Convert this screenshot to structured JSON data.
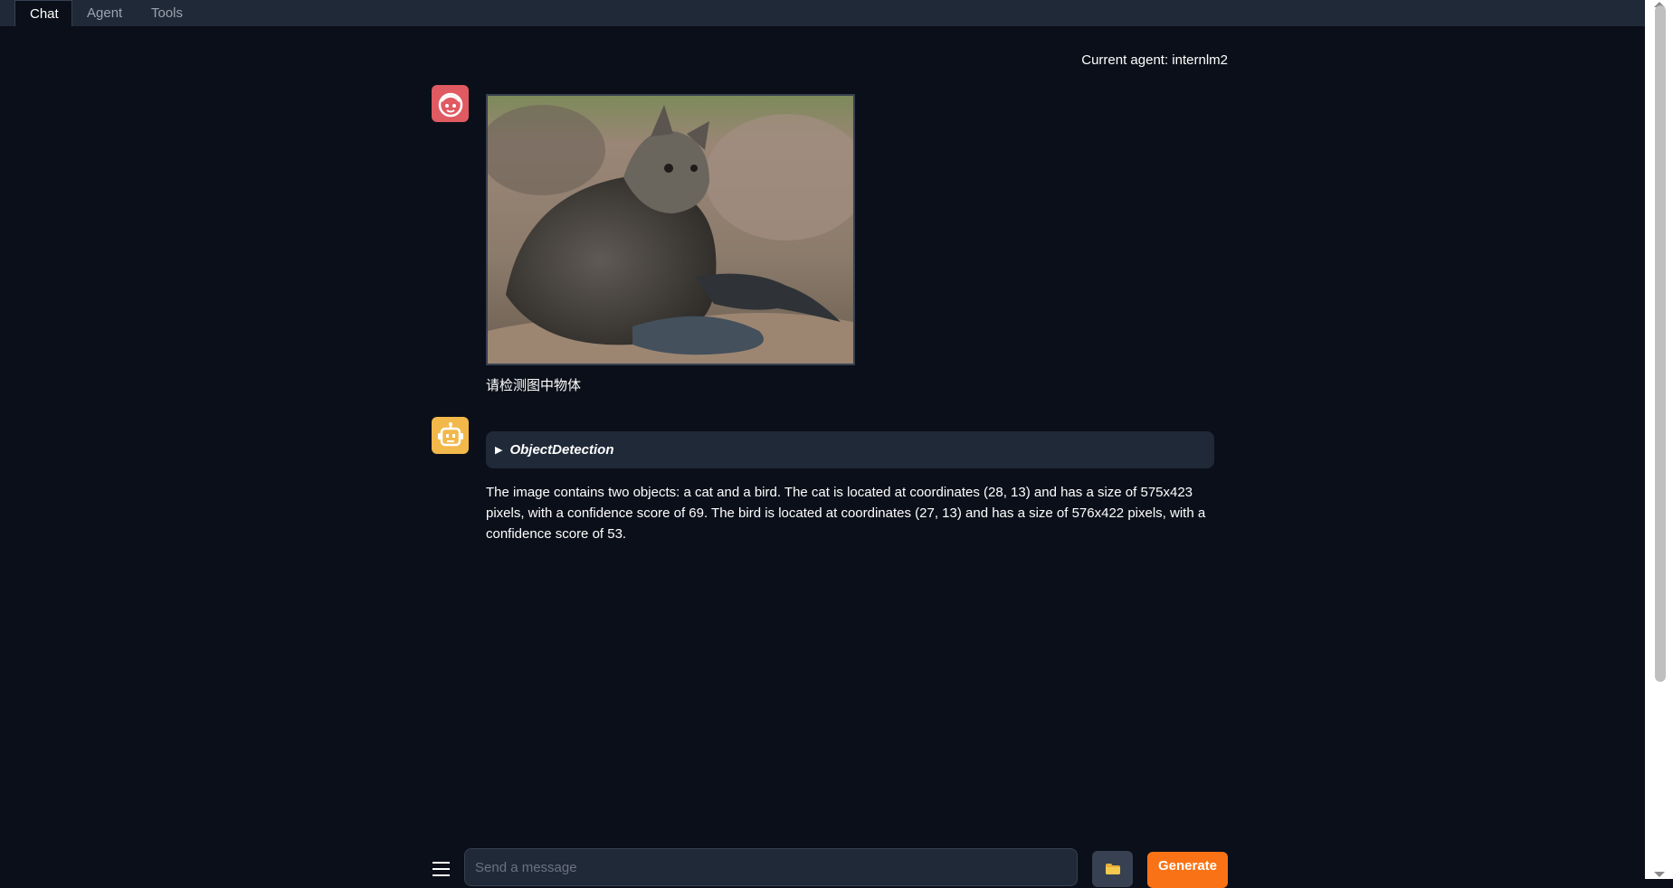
{
  "tabs": [
    {
      "label": "Chat",
      "active": true
    },
    {
      "label": "Agent",
      "active": false
    },
    {
      "label": "Tools",
      "active": false
    }
  ],
  "status": {
    "current_agent": "Current agent: internlm2"
  },
  "messages": {
    "user": {
      "avatar_icon": "user-face-icon",
      "image": "cat-photo",
      "text": "请检测图中物体"
    },
    "bot": {
      "avatar_icon": "robot-icon",
      "tool_call": "ObjectDetection",
      "text": "The image contains two objects: a cat and a bird. The cat is located at coordinates (28, 13) and has a size of 575x423 pixels, with a confidence score of 69. The bird is located at coordinates (27, 13) and has a size of 576x422 pixels, with a confidence score of 53."
    }
  },
  "composer": {
    "placeholder": "Send a message",
    "menu_icon": "hamburger-menu-icon",
    "upload_icon": "folder-icon",
    "generate_label": "Generate"
  },
  "colors": {
    "background": "#0b0f19",
    "panel": "#1f2937",
    "accent": "#f97316",
    "user_avatar": "#e05a62",
    "bot_avatar": "#f2b84a"
  }
}
